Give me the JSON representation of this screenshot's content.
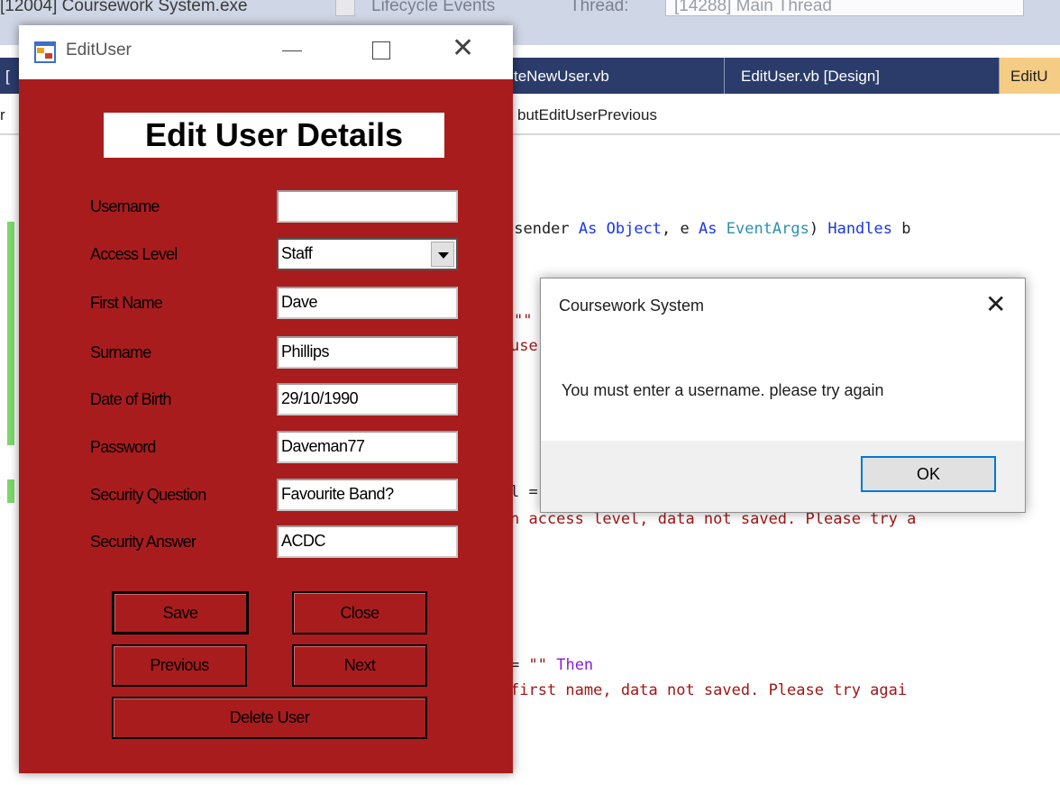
{
  "ide": {
    "toolbar": {
      "process": "[12004] Coursework System.exe",
      "lifecycle": "Lifecycle Events",
      "thread_label": "Thread:",
      "thread_value": "[14288] Main Thread"
    },
    "tabs": [
      {
        "label": "[",
        "active": false
      },
      {
        "label": "teNewUser.vb",
        "active": false
      },
      {
        "label": "EditUser.vb [Design]",
        "active": false
      },
      {
        "label": "EditU",
        "active": true
      }
    ],
    "nav": {
      "left": "r",
      "member": "butEditUserPrevious"
    },
    "code_lines": {
      "line1_a": "(sender ",
      "line1_b": "As",
      "line1_c": " ",
      "line1_d": "Object",
      "line1_e": ", e ",
      "line1_f": "As",
      "line1_g": " ",
      "line1_h": "EventArgs",
      "line1_i": ") ",
      "line1_j": "Handles",
      "line1_k": " b",
      "line2": "\"\"",
      "line3": "use",
      "line4": "l =",
      "line5": "n access level, data not saved. Please try a",
      "line6_a": "= ",
      "line6_b": "\"\"",
      "line6_c": " ",
      "line6_d": "Then",
      "line7": "first name, data not saved. Please try agai"
    }
  },
  "edit_user": {
    "window_title": "EditUser",
    "heading": "Edit User Details",
    "fields": {
      "username": {
        "label": "Username",
        "value": ""
      },
      "access_level": {
        "label": "Access Level",
        "value": "Staff"
      },
      "first_name": {
        "label": "First Name",
        "value": "Dave"
      },
      "surname": {
        "label": "Surname",
        "value": "Phillips"
      },
      "dob": {
        "label": "Date of Birth",
        "value": "29/10/1990"
      },
      "password": {
        "label": "Password",
        "value": "Daveman77"
      },
      "security_question": {
        "label": "Security Question",
        "value": "Favourite Band?"
      },
      "security_answer": {
        "label": "Security Answer",
        "value": "ACDC"
      }
    },
    "buttons": {
      "save": "Save",
      "close": "Close",
      "previous": "Previous",
      "next": "Next",
      "delete": "Delete User"
    }
  },
  "message_box": {
    "title": "Coursework System",
    "message": "You must enter a username. please try again",
    "ok": "OK"
  },
  "colors": {
    "form_background": "#a91c1d",
    "ide_tabbar": "#2b3c6b",
    "active_tab": "#f5cc84",
    "ok_button_focus": "#0078d7"
  }
}
